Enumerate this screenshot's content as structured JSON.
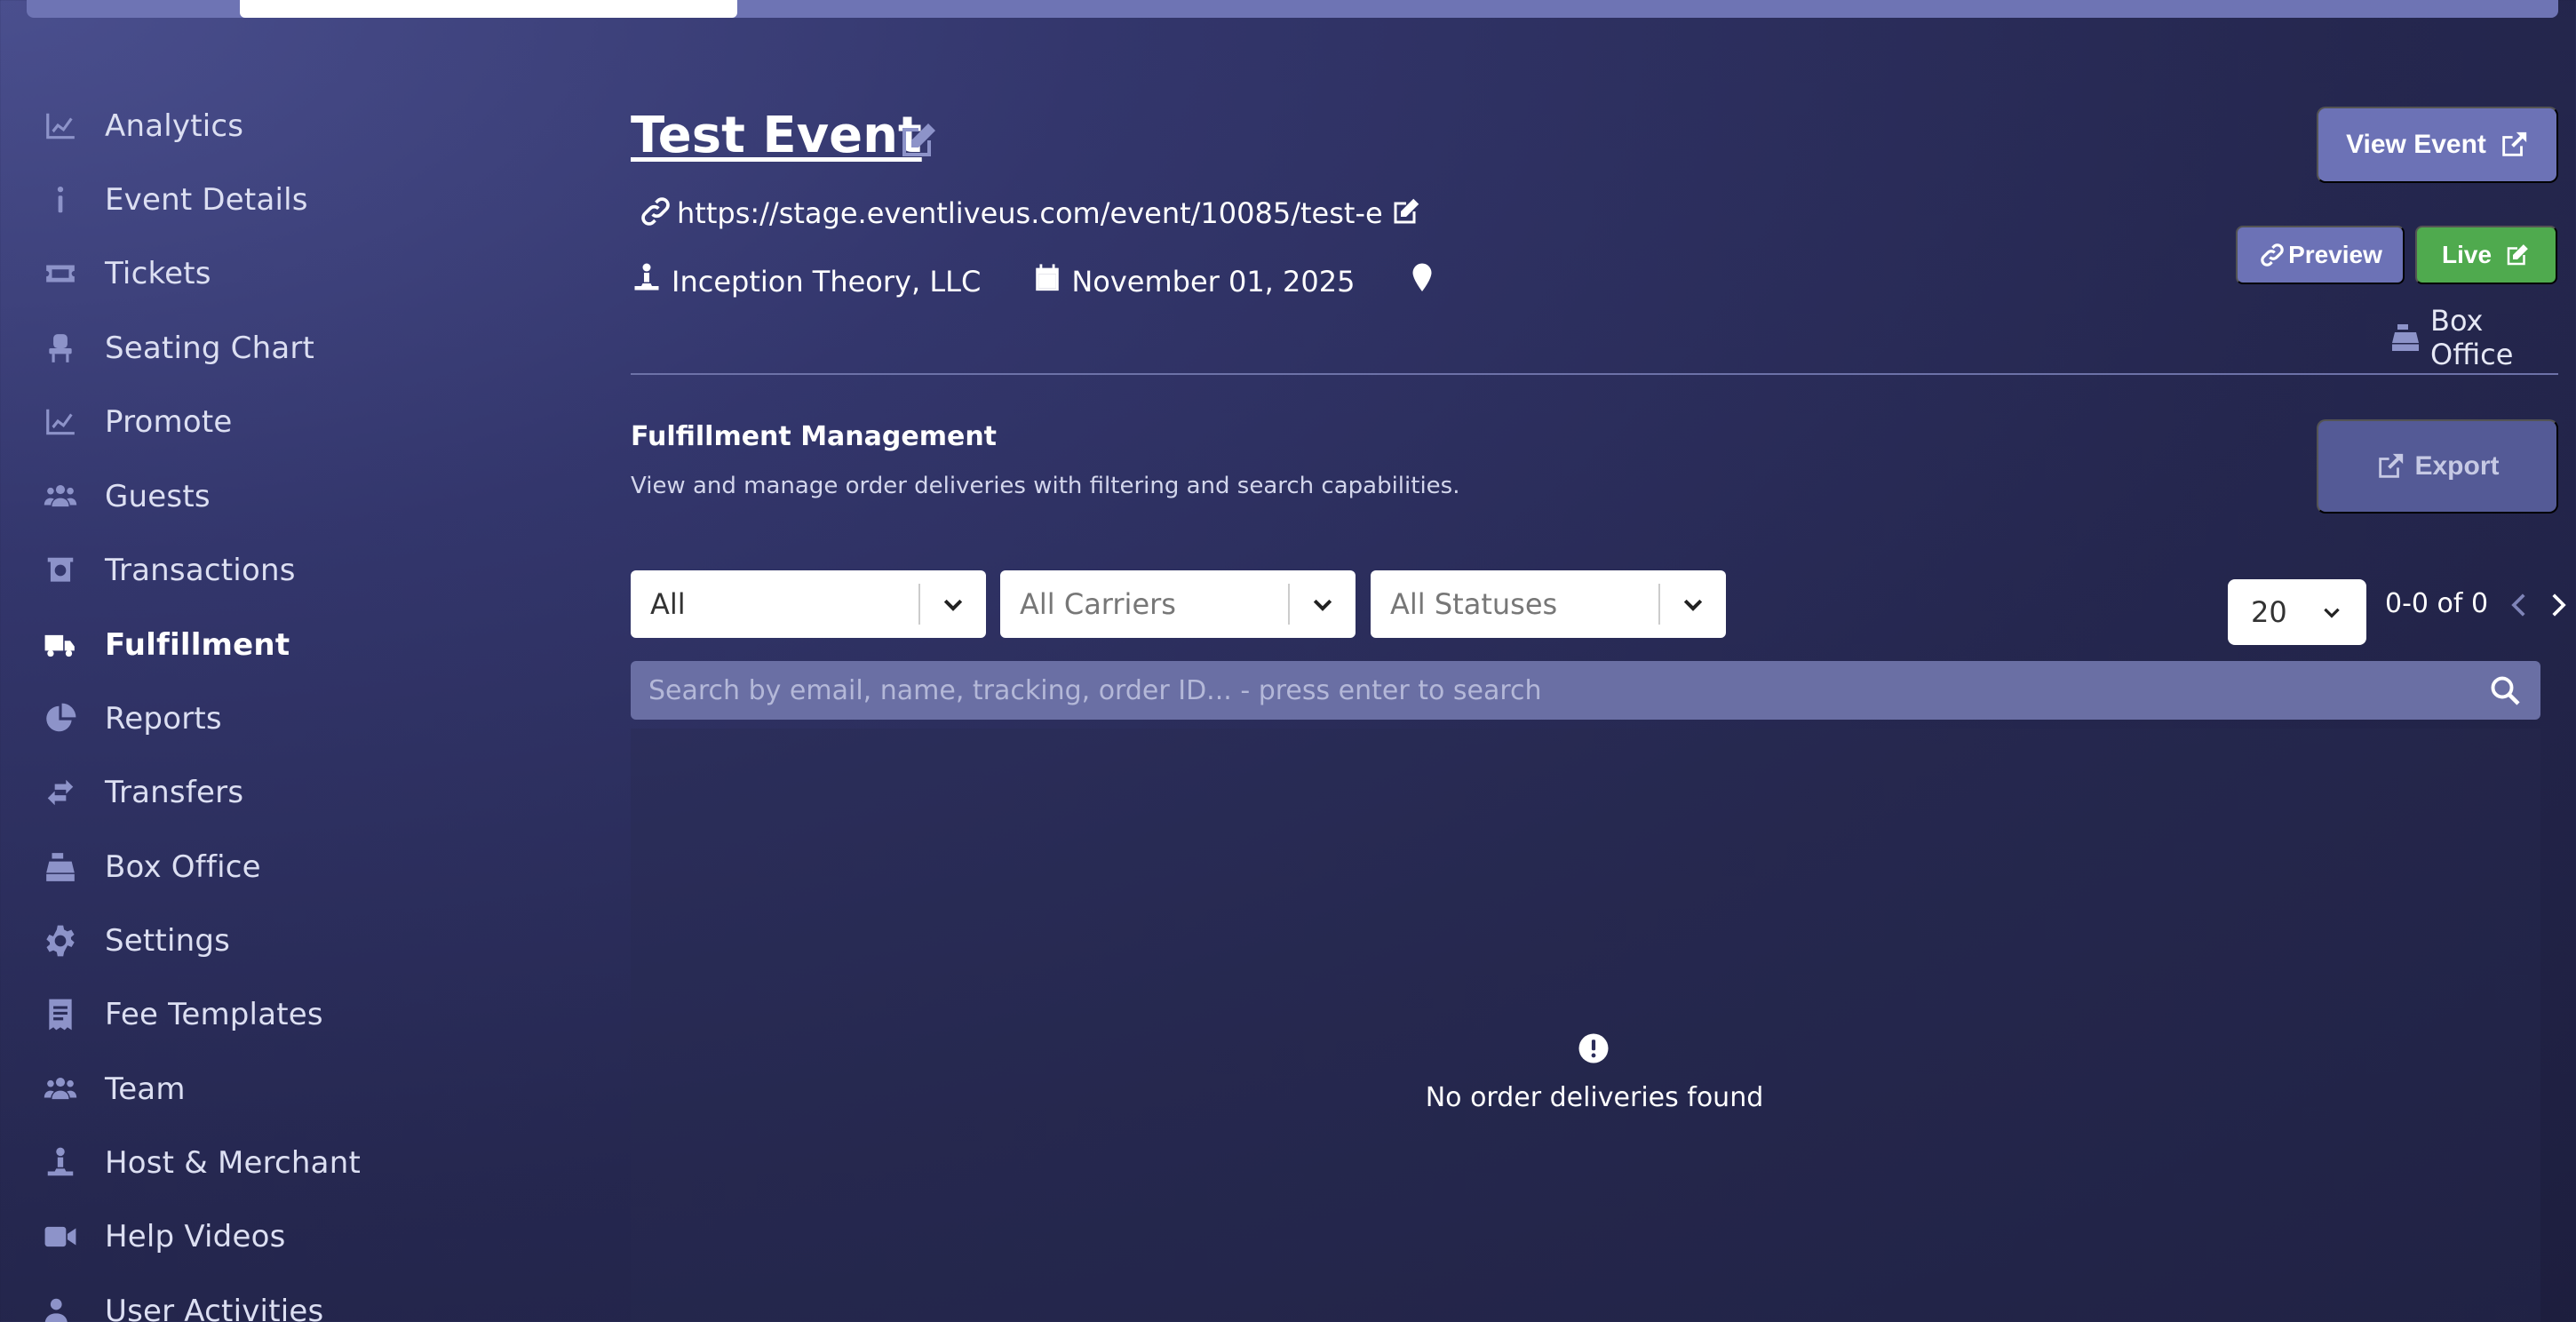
{
  "sidebar": {
    "items": [
      {
        "label": "Analytics",
        "icon": "chart-line-icon"
      },
      {
        "label": "Event Details",
        "icon": "info-icon"
      },
      {
        "label": "Tickets",
        "icon": "ticket-icon"
      },
      {
        "label": "Seating Chart",
        "icon": "chair-icon"
      },
      {
        "label": "Promote",
        "icon": "chart-line-icon"
      },
      {
        "label": "Guests",
        "icon": "users-icon"
      },
      {
        "label": "Transactions",
        "icon": "cash-register-icon"
      },
      {
        "label": "Fulfillment",
        "icon": "truck-icon",
        "active": true
      },
      {
        "label": "Reports",
        "icon": "pie-chart-icon"
      },
      {
        "label": "Transfers",
        "icon": "transfer-icon"
      },
      {
        "label": "Box Office",
        "icon": "cash-register-icon"
      },
      {
        "label": "Settings",
        "icon": "gear-icon"
      },
      {
        "label": "Fee Templates",
        "icon": "receipt-icon"
      },
      {
        "label": "Team",
        "icon": "users-icon"
      },
      {
        "label": "Host & Merchant",
        "icon": "host-icon"
      },
      {
        "label": "Help Videos",
        "icon": "video-icon"
      },
      {
        "label": "User Activities",
        "icon": "user-icon"
      }
    ]
  },
  "event": {
    "title": "Test Event",
    "url": "https://stage.eventliveus.com/event/10085/test-e",
    "host": "Inception Theory, LLC",
    "date": "November 01, 2025"
  },
  "actions": {
    "view_event": "View Event",
    "preview": "Preview",
    "live": "Live",
    "box_office": "Box Office"
  },
  "section": {
    "title": "Fulfillment Management",
    "description": "View and manage order deliveries with filtering and search capabilities.",
    "export": "Export"
  },
  "filters": {
    "type": "All",
    "carrier_placeholder": "All Carriers",
    "status_placeholder": "All Statuses"
  },
  "pagination": {
    "per_page": "20",
    "range": "0-0 of 0"
  },
  "search": {
    "placeholder": "Search by email, name, tracking, order ID... - press enter to search"
  },
  "empty_state": {
    "message": "No order deliveries found"
  },
  "colors": {
    "accent": "#6c72b6",
    "live": "#4faa4e",
    "background": "#2a2c5a"
  }
}
